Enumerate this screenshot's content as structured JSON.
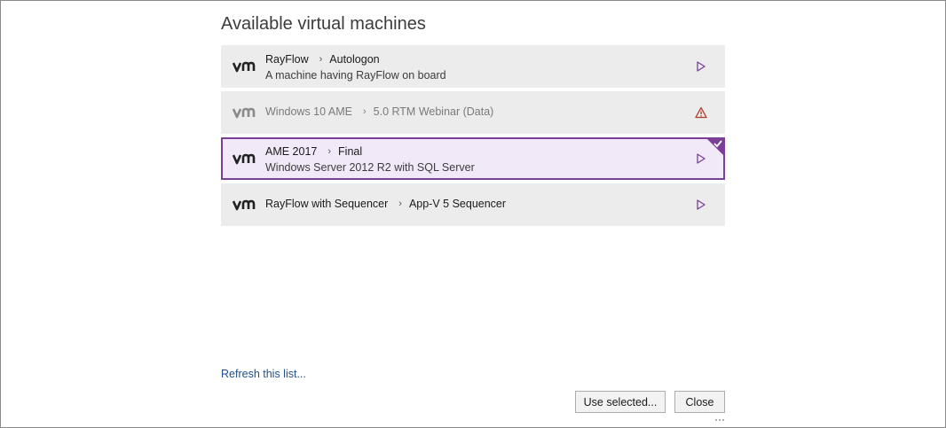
{
  "dialog": {
    "title": "Available virtual machines"
  },
  "vms": [
    {
      "name": "RayFlow",
      "snapshot": "Autologon",
      "description": "A machine having RayFlow on board",
      "state": "normal",
      "action_icon": "play-icon"
    },
    {
      "name": "Windows 10 AME",
      "snapshot": "5.0 RTM Webinar (Data)",
      "description": "",
      "state": "warning",
      "action_icon": "warning-icon"
    },
    {
      "name": "AME 2017",
      "snapshot": "Final",
      "description": "Windows Server 2012 R2 with SQL Server",
      "state": "selected",
      "action_icon": "play-icon"
    },
    {
      "name": "RayFlow with Sequencer",
      "snapshot": "App-V 5 Sequencer",
      "description": "",
      "state": "normal",
      "action_icon": "play-icon"
    }
  ],
  "separator_glyph": "›",
  "footer": {
    "refresh_link": "Refresh this list...",
    "use_selected_label": "Use selected...",
    "close_label": "Close"
  },
  "colors": {
    "accent": "#7b3f98",
    "selected_bg": "#f1e9f7",
    "item_bg": "#ececec",
    "warning": "#c0392b",
    "link": "#1f4e8c"
  }
}
